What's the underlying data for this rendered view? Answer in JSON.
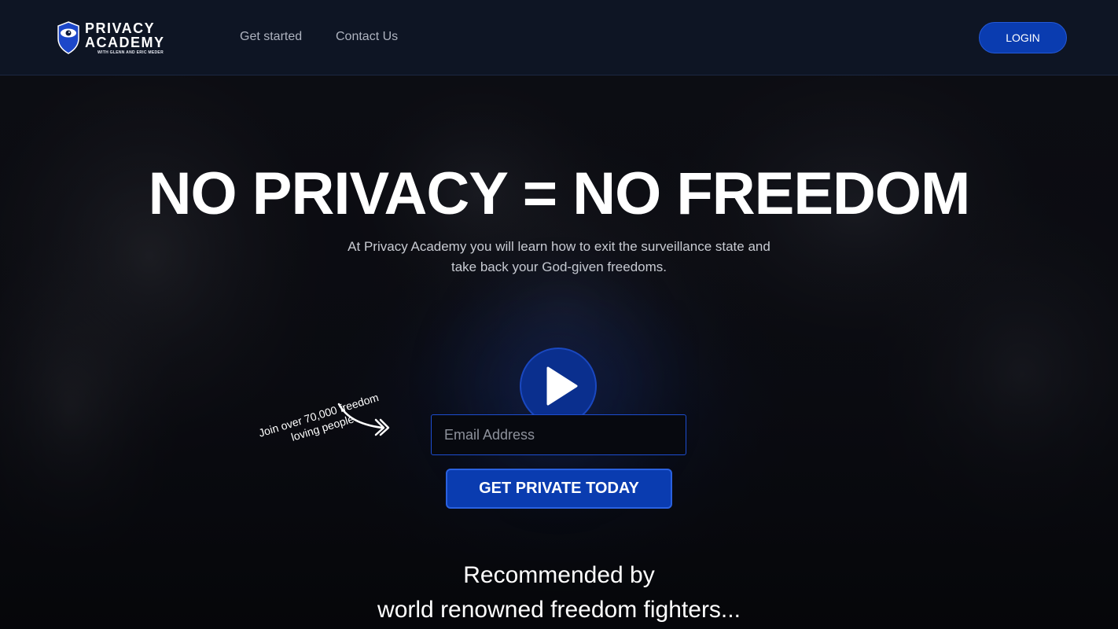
{
  "header": {
    "logo": {
      "line1": "PRIVACY",
      "line2": "ACADEMY",
      "tagline": "WITH GLENN AND ERIC MEDER",
      "icon": "eye-shield-icon"
    },
    "nav": {
      "get_started": "Get started",
      "contact_us": "Contact Us"
    },
    "login_label": "LOGIN"
  },
  "hero": {
    "headline": "NO PRIVACY = NO FREEDOM",
    "subtitle_line1": "At Privacy Academy you will learn how to exit the surveillance state and",
    "subtitle_line2": "take back your God-given freedoms.",
    "play_icon": "play-icon",
    "join_line1": "Join over 70,000 freedom",
    "join_line2": "loving people",
    "email_placeholder": "Email Address",
    "email_value": "",
    "cta_label": "GET PRIVATE TODAY",
    "recommended_line1": "Recommended by",
    "recommended_line2": "world renowned freedom fighters..."
  },
  "colors": {
    "accent_blue": "#0a3cb0",
    "header_bg": "#0e1524",
    "hero_bg": "#08090e"
  }
}
